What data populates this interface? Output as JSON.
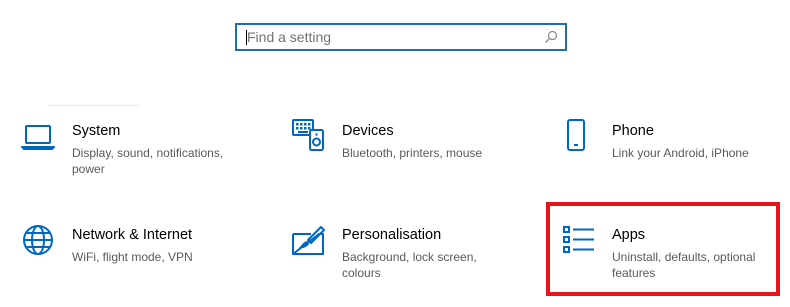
{
  "search": {
    "placeholder": "Find a setting",
    "value": ""
  },
  "categories": [
    {
      "title": "System",
      "desc": "Display, sound, notifications, power",
      "icon": "laptop-icon"
    },
    {
      "title": "Devices",
      "desc": "Bluetooth, printers, mouse",
      "icon": "devices-icon"
    },
    {
      "title": "Phone",
      "desc": "Link your Android, iPhone",
      "icon": "phone-icon"
    },
    {
      "title": "Network & Internet",
      "desc": "WiFi, flight mode, VPN",
      "icon": "globe-icon"
    },
    {
      "title": "Personalisation",
      "desc": "Background, lock screen, colours",
      "icon": "paintbrush-icon"
    },
    {
      "title": "Apps",
      "desc": "Uninstall, defaults, optional features",
      "icon": "apps-list-icon"
    }
  ],
  "colors": {
    "accent": "#0067c0",
    "search_border": "#1f6fa8",
    "highlight": "#e8141d",
    "desc_text": "#595959"
  }
}
